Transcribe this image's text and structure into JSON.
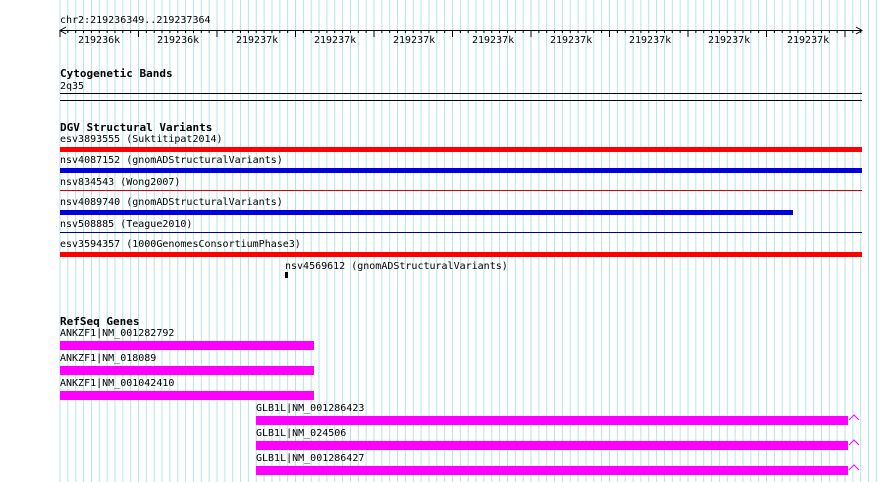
{
  "ruler": {
    "location": "chr2:219236349..219237364",
    "ticks": [
      "219236k",
      "219236k",
      "219237k",
      "219237k",
      "219237k",
      "219237k",
      "219237k",
      "219237k",
      "219237k",
      "219237k"
    ]
  },
  "cytogenetic": {
    "title": "Cytogenetic Bands",
    "band": "2q35"
  },
  "dgv": {
    "title": "DGV Structural Variants",
    "features": [
      {
        "label": "esv3893555 (Suktitipat2014)",
        "color": "#ff0000"
      },
      {
        "label": "nsv4087152 (gnomADStructuralVariants)",
        "color": "#0000dd"
      },
      {
        "label": "nsv834543 (Wong2007)",
        "color": "#cc0000"
      },
      {
        "label": "nsv4089740 (gnomADStructuralVariants)",
        "color": "#0000dd"
      },
      {
        "label": "nsv508885 (Teague2010)",
        "color": "#000080"
      },
      {
        "label": "esv3594357 (1000GenomesConsortiumPhase3)",
        "color": "#ff0000"
      },
      {
        "label": "nsv4569612 (gnomADStructuralVariants)",
        "color": "#000000"
      }
    ]
  },
  "refseq": {
    "title": "RefSeq Genes",
    "color": "#ff00ff",
    "genes": [
      {
        "label": "ANKZF1|NM_001282792"
      },
      {
        "label": "ANKZF1|NM_018089"
      },
      {
        "label": "ANKZF1|NM_001042410"
      },
      {
        "label": "GLB1L|NM_001286423"
      },
      {
        "label": "GLB1L|NM_024506"
      },
      {
        "label": "GLB1L|NM_001286427"
      }
    ]
  }
}
